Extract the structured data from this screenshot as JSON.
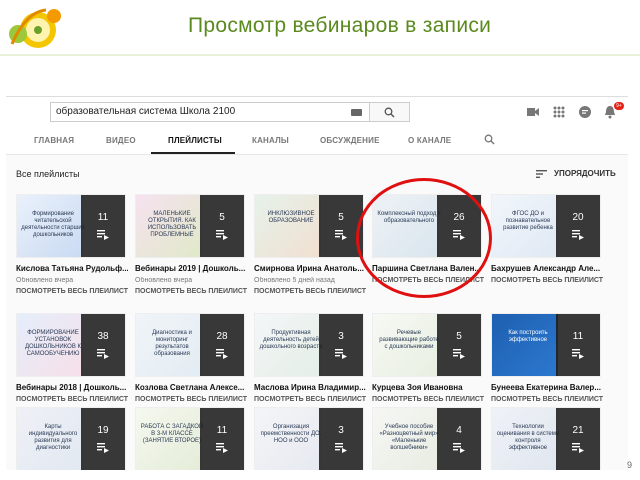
{
  "slide": {
    "title": "Просмотр вебинаров в записи",
    "logo_text": "ДЕТСКИЙ САД",
    "accent": "#5a8a1e"
  },
  "masthead": {
    "search_value": "образовательная система Школа 2100",
    "icons": [
      "keyboard-icon",
      "search-icon",
      "video-camera-icon",
      "apps-grid-icon",
      "chat-icon",
      "bell-icon"
    ],
    "notifications": "9+"
  },
  "tabs": [
    {
      "label": "ГЛАВНАЯ"
    },
    {
      "label": "ВИДЕО"
    },
    {
      "label": "ПЛЕЙЛИСТЫ"
    },
    {
      "label": "КАНАЛЫ"
    },
    {
      "label": "ОБСУЖДЕНИЕ"
    },
    {
      "label": "О КАНАЛЕ"
    }
  ],
  "section": {
    "title": "Все плейлисты",
    "sort_label": "УПОРЯДОЧИТЬ"
  },
  "playlists": [
    {
      "count": "11",
      "title": "Кислова Татьяна Рудольф...",
      "meta": "Обновлено вчера",
      "link": "ПОСМОТРЕТЬ ВЕСЬ ПЛЕЙЛИСТ",
      "caption": "Формирование читательской деятельности старших дошкольников"
    },
    {
      "count": "5",
      "title": "Вебинары 2019 | Дошколь...",
      "meta": "Обновлено вчера",
      "link": "ПОСМОТРЕТЬ ВЕСЬ ПЛЕЙЛИСТ",
      "caption": "МАЛЕНЬКИЕ ОТКРЫТИЯ. КАК ИСПОЛЬЗОВАТЬ ПРОБЛЕМНЫЕ"
    },
    {
      "count": "5",
      "title": "Смирнова Ирина Анатоль...",
      "meta": "Обновлено 5 дней назад",
      "link": "ПОСМОТРЕТЬ ВЕСЬ ПЛЕЙЛИСТ",
      "caption": "ИНКЛЮЗИВНОЕ ОБРАЗОВАНИЕ"
    },
    {
      "count": "26",
      "title": "Паршина Светлана Вален...",
      "meta": "",
      "link": "ПОСМОТРЕТЬ ВЕСЬ ПЛЕЙЛИСТ",
      "caption": "Комплексный подход к образовательного"
    },
    {
      "count": "20",
      "title": "Бахрушев Александр Але...",
      "meta": "",
      "link": "ПОСМОТРЕТЬ ВЕСЬ ПЛЕЙЛИСТ",
      "caption": "ФГОС ДО и познавательное развитие ребенка"
    },
    {
      "count": "38",
      "title": "Вебинары 2018 | Дошколь...",
      "meta": "",
      "link": "ПОСМОТРЕТЬ ВЕСЬ ПЛЕЙЛИСТ",
      "caption": "ФОРМИРОВАНИЕ УСТАНОВОК ДОШКОЛЬНИКОВ К САМООБУЧЕНИЮ"
    },
    {
      "count": "28",
      "title": "Козлова Светлана Алексе...",
      "meta": "",
      "link": "ПОСМОТРЕТЬ ВЕСЬ ПЛЕЙЛИСТ",
      "caption": "Диагностика и мониторинг результатов образования"
    },
    {
      "count": "3",
      "title": "Маслова Ирина Владимир...",
      "meta": "",
      "link": "ПОСМОТРЕТЬ ВЕСЬ ПЛЕЙЛИСТ",
      "caption": "Продуктивная деятельность детей дошкольного возраста"
    },
    {
      "count": "5",
      "title": "Курцева Зоя Ивановна",
      "meta": "",
      "link": "ПОСМОТРЕТЬ ВЕСЬ ПЛЕЙЛИСТ",
      "caption": "Речевые развивающие работе с дошкольниками"
    },
    {
      "count": "11",
      "title": "Бунеева Екатерина Валер...",
      "meta": "",
      "link": "ПОСМОТРЕТЬ ВЕСЬ ПЛЕЙЛИСТ",
      "caption": "Как построить эффективное"
    },
    {
      "count": "19",
      "title": "",
      "meta": "",
      "link": "",
      "caption": "Карты индивидуального развития для диагностики"
    },
    {
      "count": "11",
      "title": "",
      "meta": "",
      "link": "",
      "caption": "РАБОТА С ЗАГАДКОЙ В 3-М КЛАССЕ (ЗАНЯТИЕ ВТОРОЕ)"
    },
    {
      "count": "3",
      "title": "",
      "meta": "",
      "link": "",
      "caption": "Организация преемственности ДО, НОО и ООО"
    },
    {
      "count": "4",
      "title": "",
      "meta": "",
      "link": "",
      "caption": "Учебное пособие «Разноцветный мир» «Маленькие волшебники»"
    },
    {
      "count": "21",
      "title": "",
      "meta": "",
      "link": "",
      "caption": "Технологии оценивания в системе контроля эффективное"
    }
  ]
}
